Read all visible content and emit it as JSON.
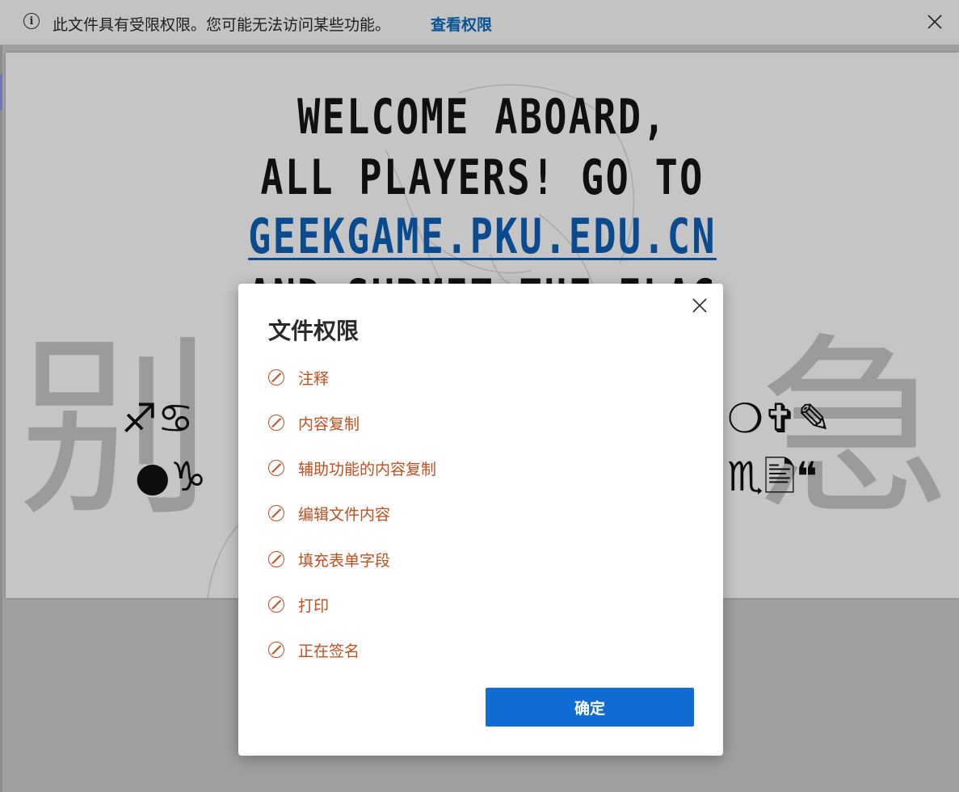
{
  "infobar": {
    "message": "此文件具有受限权限。您可能无法访问某些功能。",
    "link": "查看权限",
    "icon": "info-icon",
    "close_icon": "close-icon"
  },
  "document": {
    "title_lines": [
      "WELCOME ABOARD,",
      "ALL PLAYERS! GO TO"
    ],
    "title_link": "GEEKGAME.PKU.EDU.CN",
    "title_partial": "AND SUBMIT THE FLAG",
    "watermark_left": "别",
    "watermark_right": "急",
    "symbols_row1_left": "♐♋",
    "symbols_row1_right": "❍✞✎",
    "symbols_row2_left": "●♑",
    "symbols_row2_right": "♏🖹❝"
  },
  "dialog": {
    "title": "文件权限",
    "items": [
      "注释",
      "内容复制",
      "辅助功能的内容复制",
      "编辑文件内容",
      "填充表单字段",
      "打印",
      "正在签名"
    ],
    "ok_label": "确定",
    "item_icon": "prohibited-icon",
    "accent_color": "#c14d1b",
    "button_color": "#0f6cd3"
  }
}
